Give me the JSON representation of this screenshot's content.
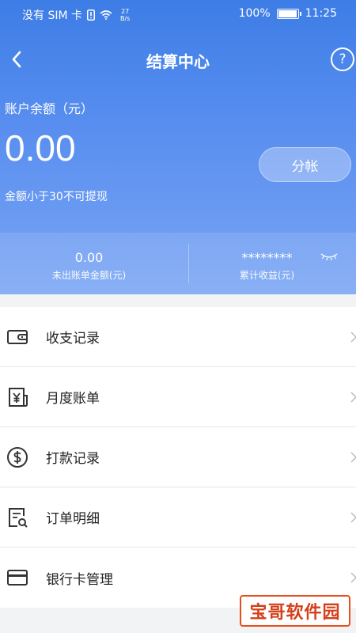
{
  "status_bar": {
    "carrier": "没有 SIM 卡",
    "speed_value": "27",
    "speed_unit": "B/s",
    "battery": "100%",
    "time": "11:25"
  },
  "nav": {
    "title": "结算中心",
    "help": "?"
  },
  "balance": {
    "label": "账户余额（元）",
    "value": "0.00",
    "note": "金额小于30不可提现",
    "split_button": "分帐"
  },
  "stats": {
    "unbilled": {
      "value": "0.00",
      "label": "未出账单金额(元)"
    },
    "earnings": {
      "value": "********",
      "label": "累计收益(元)"
    }
  },
  "menu": [
    {
      "label": "收支记录",
      "icon": "wallet-icon"
    },
    {
      "label": "月度账单",
      "icon": "yen-bill-icon"
    },
    {
      "label": "打款记录",
      "icon": "dollar-circle-icon"
    },
    {
      "label": "订单明细",
      "icon": "order-search-icon"
    },
    {
      "label": "银行卡管理",
      "icon": "bank-card-icon"
    }
  ],
  "watermark": "宝哥软件园",
  "colors": {
    "header_gradient_top": "#3d7de6",
    "header_gradient_bottom": "#79a5f4",
    "watermark": "#d3401a"
  }
}
